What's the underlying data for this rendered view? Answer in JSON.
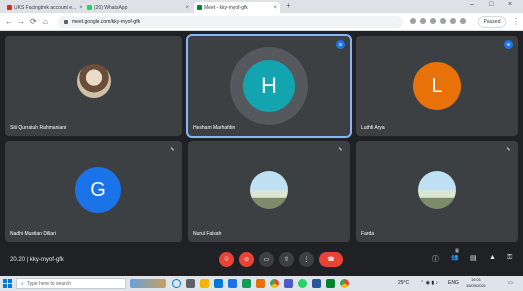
{
  "browser": {
    "tabs": [
      {
        "title": "UKS Facingtrek account e...",
        "favicon_color": "#d93025"
      },
      {
        "title": "(20) WhatsApp",
        "favicon_color": "#25d366"
      },
      {
        "title": "Meet - kky-myof-gfk",
        "favicon_color": "#00832d"
      }
    ],
    "new_tab_label": "+",
    "close_label": "×",
    "url": "meet.google.com/kky-myof-gfk",
    "profile_label": "Paused",
    "window_controls": [
      "–",
      "□",
      "×"
    ]
  },
  "meet": {
    "participants": [
      {
        "name": "Siti Qurratuh Rahmaniani",
        "type": "photo",
        "indicator": ""
      },
      {
        "name": "Hesham Marhafdin",
        "type": "letter",
        "letter": "H",
        "color": "#12a4af",
        "indicator": "speaking"
      },
      {
        "name": "Luthfi Arya",
        "type": "letter",
        "letter": "L",
        "color": "#e8710a",
        "indicator": "speaking"
      },
      {
        "name": "Nadhi Mustian Dillari",
        "type": "letter",
        "letter": "G",
        "color": "#1a73e8",
        "indicator": "muted"
      },
      {
        "name": "Nurul Falsah",
        "type": "photo",
        "indicator": "muted"
      },
      {
        "name": "Farda",
        "type": "photo",
        "indicator": "muted"
      }
    ],
    "indicator_icons": {
      "speaking": "audio-wave-icon",
      "muted": "mic-off-icon"
    },
    "meeting_time": "20.20",
    "meeting_code": "kky-myof-gfk",
    "controls": [
      {
        "name": "mic-toggle",
        "icon": "mic-off-icon",
        "glyph": "⦸"
      },
      {
        "name": "camera-toggle",
        "icon": "camera-off-icon",
        "glyph": "⊘"
      },
      {
        "name": "captions-toggle",
        "icon": "captions-icon",
        "glyph": "▭"
      },
      {
        "name": "present-now",
        "icon": "present-icon",
        "glyph": "⇧"
      },
      {
        "name": "more-options",
        "icon": "more-vert-icon",
        "glyph": "⋮"
      },
      {
        "name": "leave-call",
        "icon": "call-end-icon",
        "glyph": "☎"
      }
    ],
    "right_controls": [
      {
        "name": "meeting-details",
        "icon": "info-icon",
        "glyph": "ⓘ"
      },
      {
        "name": "people",
        "icon": "people-icon",
        "glyph": "👥"
      },
      {
        "name": "chat",
        "icon": "chat-icon",
        "glyph": "▤"
      },
      {
        "name": "activities",
        "icon": "activities-icon",
        "glyph": "▲"
      },
      {
        "name": "host-controls",
        "icon": "lock-person-icon",
        "glyph": "⚿"
      }
    ],
    "people_badge": "6"
  },
  "taskbar": {
    "search_placeholder": "Type here to search",
    "tray_left": "29°C",
    "tray_lang": "ENG",
    "clock_time": "19.01",
    "clock_date": "15/09/2021"
  },
  "colors": {
    "stage_bg": "#202124",
    "tile_bg": "#3c4043",
    "accent_blue": "#1a73e8",
    "danger_red": "#ea4335"
  }
}
